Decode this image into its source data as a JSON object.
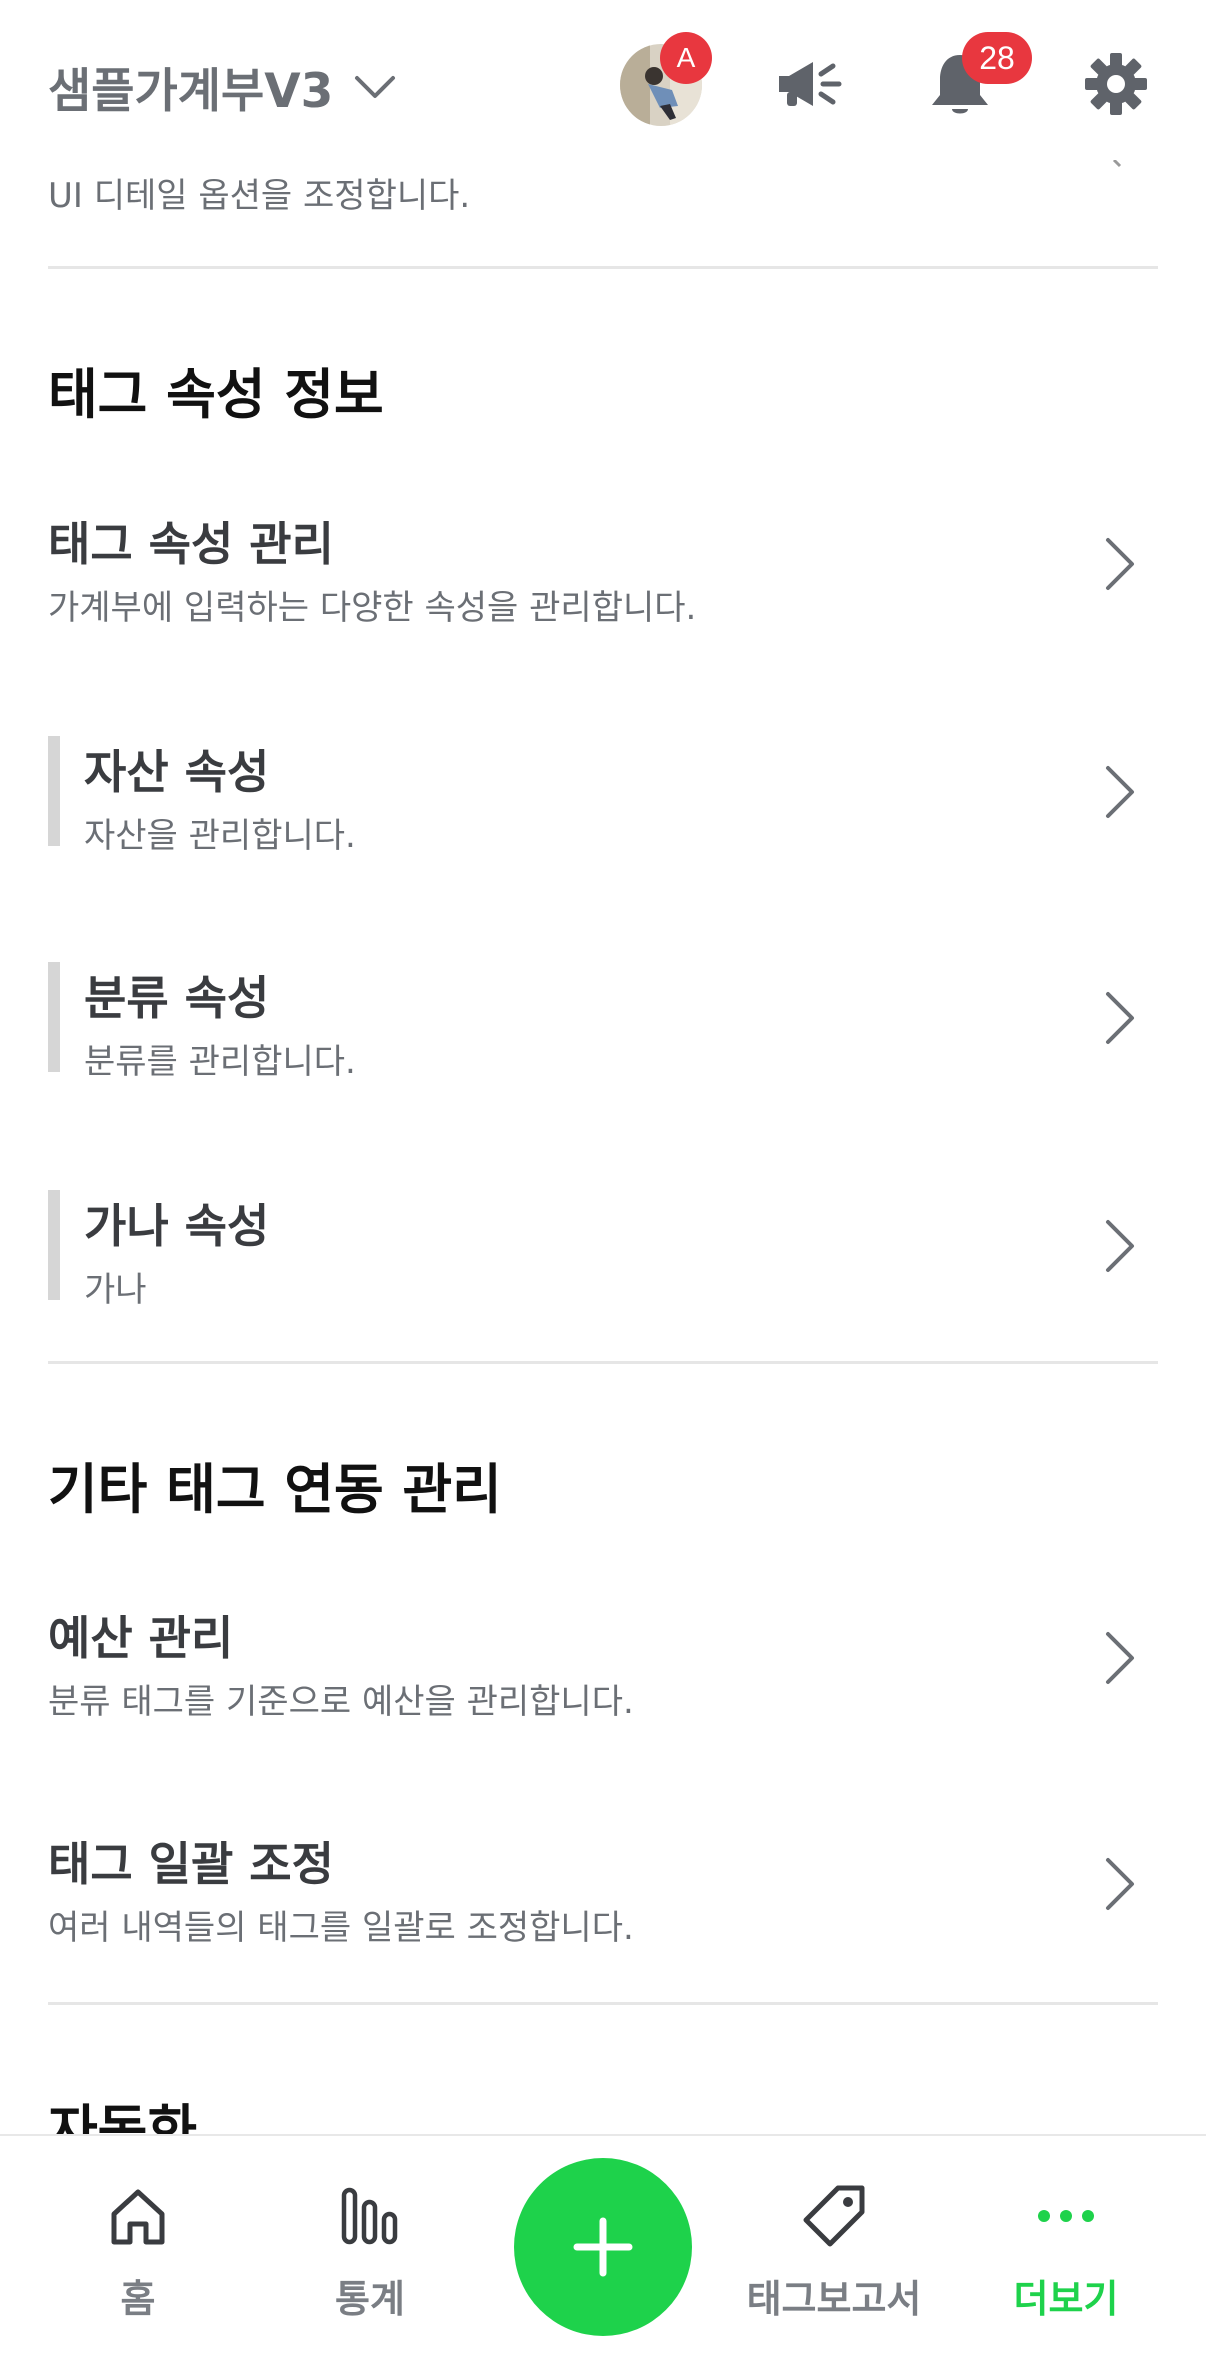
{
  "header": {
    "book_title": "샘플가계부V3",
    "avatar_badge": "A",
    "notification_count": "28"
  },
  "partial_item": {
    "subtitle": "UI 디테일 옵션을 조정합니다."
  },
  "sections": [
    {
      "title": "태그 속성 정보",
      "items": [
        {
          "title": "태그 속성 관리",
          "subtitle": "가계부에 입력하는 다양한 속성을 관리합니다."
        },
        {
          "title": "자산 속성",
          "subtitle": "자산을 관리합니다."
        },
        {
          "title": "분류 속성",
          "subtitle": "분류를 관리합니다."
        },
        {
          "title": "가나 속성",
          "subtitle": "가나"
        }
      ]
    },
    {
      "title": "기타 태그 연동 관리",
      "items": [
        {
          "title": "예산 관리",
          "subtitle": "분류 태그를 기준으로 예산을 관리합니다."
        },
        {
          "title": "태그 일괄 조정",
          "subtitle": "여러 내역들의 태그를 일괄로 조정합니다."
        }
      ]
    },
    {
      "title": "자동화"
    }
  ],
  "bottom_nav": {
    "items": [
      {
        "label": "홈",
        "icon": "home-icon"
      },
      {
        "label": "통계",
        "icon": "stats-icon"
      },
      {
        "label": "태그보고서",
        "icon": "tag-icon"
      },
      {
        "label": "더보기",
        "icon": "more-icon"
      }
    ],
    "add_icon": "plus-icon",
    "active_color": "#1ed24b",
    "inactive_color": "#7a7e84"
  },
  "colors": {
    "accent": "#1ed24b",
    "badge": "#e8373f"
  }
}
